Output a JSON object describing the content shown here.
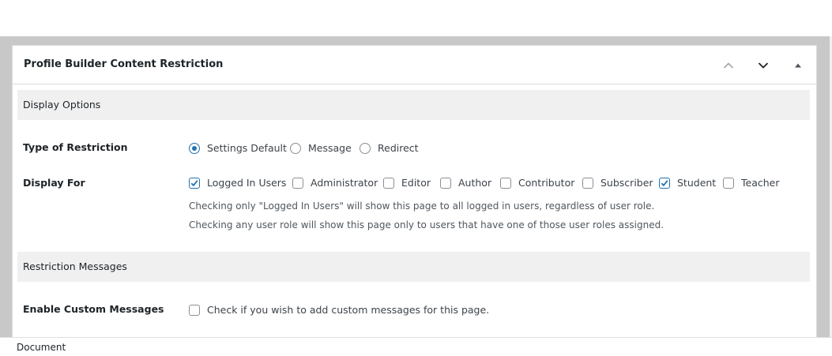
{
  "metabox": {
    "title": "Profile Builder Content Restriction",
    "controls": [
      "chevron-up-icon",
      "chevron-down-icon",
      "triangle-up-icon"
    ]
  },
  "display_options": {
    "heading": "Display Options",
    "type_of_restriction": {
      "label": "Type of Restriction",
      "options": [
        {
          "label": "Settings Default",
          "selected": true
        },
        {
          "label": "Message",
          "selected": false
        },
        {
          "label": "Redirect",
          "selected": false
        }
      ]
    },
    "display_for": {
      "label": "Display For",
      "options": [
        {
          "label": "Logged In Users",
          "checked": true
        },
        {
          "label": "Administrator",
          "checked": false
        },
        {
          "label": "Editor",
          "checked": false
        },
        {
          "label": "Author",
          "checked": false
        },
        {
          "label": "Contributor",
          "checked": false
        },
        {
          "label": "Subscriber",
          "checked": false
        },
        {
          "label": "Student",
          "checked": true
        },
        {
          "label": "Teacher",
          "checked": false
        }
      ],
      "help_1": "Checking only \"Logged In Users\" will show this page to all logged in users, regardless of user role.",
      "help_2": "Checking any user role will show this page only to users that have one of those user roles assigned."
    }
  },
  "restriction_messages": {
    "heading": "Restriction Messages",
    "enable_custom": {
      "label": "Enable Custom Messages",
      "option_label": "Check if you wish to add custom messages for this page.",
      "checked": false
    }
  },
  "footer": {
    "label": "Document"
  },
  "colors": {
    "accent": "#2271b1",
    "section_bg": "#f0f0f1",
    "backdrop": "#c8c8c8"
  }
}
